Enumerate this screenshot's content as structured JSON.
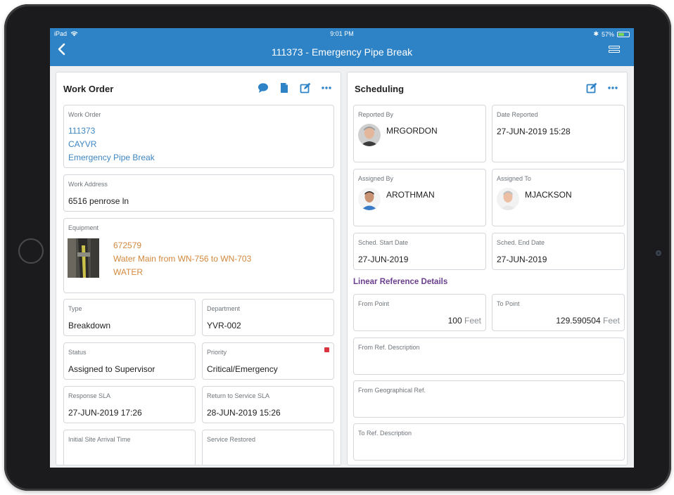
{
  "status_bar": {
    "carrier": "iPad",
    "time": "9:01 PM",
    "battery": "57%",
    "battery_level": 0.57
  },
  "nav": {
    "title": "111373 - Emergency Pipe Break"
  },
  "work_order_panel": {
    "title": "Work Order",
    "icons": [
      "comment-icon",
      "document-icon",
      "edit-icon",
      "more-icon"
    ],
    "work_order": {
      "label": "Work Order",
      "number": "111373",
      "code": "CAYVR",
      "name": "Emergency Pipe Break"
    },
    "work_address": {
      "label": "Work Address",
      "value": "6516 penrose ln"
    },
    "equipment": {
      "label": "Equipment",
      "id": "672579",
      "description": "Water Main from WN-756 to WN-703",
      "type": "WATER"
    },
    "type": {
      "label": "Type",
      "value": "Breakdown"
    },
    "department": {
      "label": "Department",
      "value": "YVR-002"
    },
    "status": {
      "label": "Status",
      "value": "Assigned to Supervisor"
    },
    "priority": {
      "label": "Priority",
      "value": "Critical/Emergency",
      "color": "#d9343f"
    },
    "response_sla": {
      "label": "Response SLA",
      "value": "27-JUN-2019 17:26"
    },
    "return_sla": {
      "label": "Return to Service SLA",
      "value": "28-JUN-2019 15:26"
    },
    "initial_arrival": {
      "label": "Initial Site Arrival Time",
      "value": ""
    },
    "service_restored": {
      "label": "Service Restored",
      "value": ""
    }
  },
  "scheduling_panel": {
    "title": "Scheduling",
    "icons": [
      "edit-icon",
      "more-icon"
    ],
    "reported_by": {
      "label": "Reported By",
      "value": "MRGORDON"
    },
    "date_reported": {
      "label": "Date Reported",
      "value": "27-JUN-2019 15:28"
    },
    "assigned_by": {
      "label": "Assigned By",
      "value": "AROTHMAN"
    },
    "assigned_to": {
      "label": "Assigned To",
      "value": "MJACKSON"
    },
    "sched_start": {
      "label": "Sched. Start Date",
      "value": "27-JUN-2019"
    },
    "sched_end": {
      "label": "Sched. End Date",
      "value": "27-JUN-2019"
    },
    "linear_reference": {
      "title": "Linear Reference Details",
      "from_point": {
        "label": "From Point",
        "value": "100",
        "unit": "Feet"
      },
      "to_point": {
        "label": "To Point",
        "value": "129.590504",
        "unit": "Feet"
      },
      "from_ref_description": {
        "label": "From Ref. Description",
        "value": ""
      },
      "from_geographical_ref": {
        "label": "From Geographical Ref.",
        "value": ""
      },
      "to_ref_description": {
        "label": "To Ref. Description",
        "value": ""
      }
    }
  },
  "colors": {
    "nav_bar": "#2e82c6",
    "link": "#3f86c3",
    "equipment_text": "#d3883d",
    "section_title": "#6b3f8e",
    "priority": "#d9343f"
  }
}
